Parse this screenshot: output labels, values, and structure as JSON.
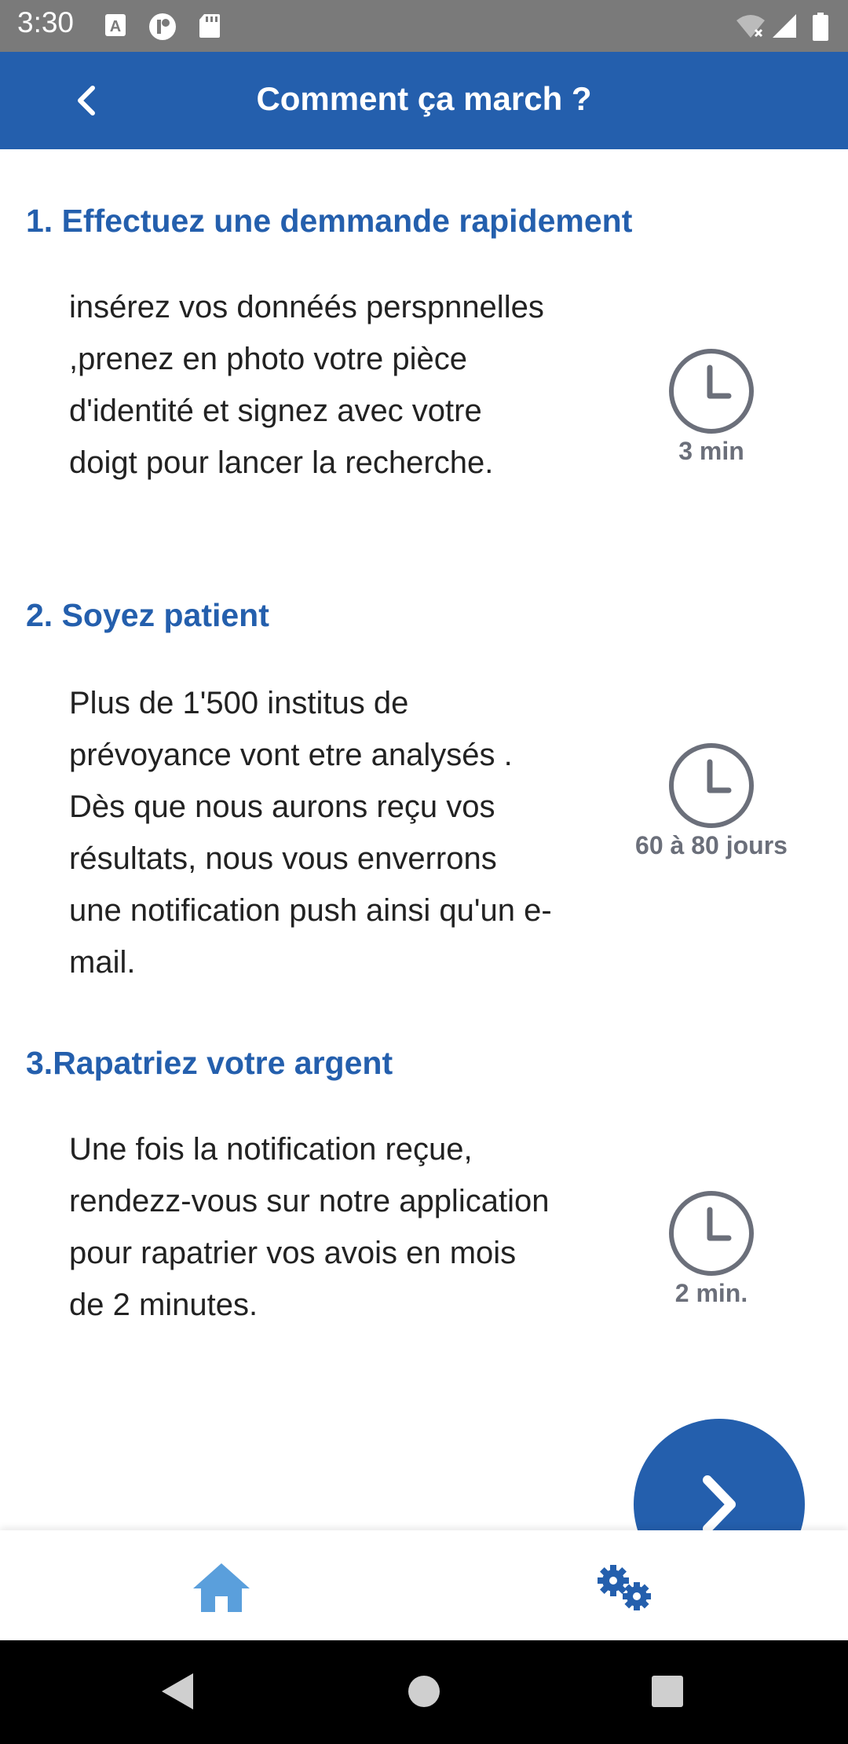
{
  "status_bar": {
    "time": "3:30",
    "icons_left": [
      "keyboard-a-icon",
      "notification-app-icon",
      "sd-card-icon"
    ],
    "icons_right": [
      "wifi-icon",
      "signal-icon",
      "battery-icon"
    ]
  },
  "app_bar": {
    "title": "Comment ça march ?",
    "back_icon": "chevron-left-icon"
  },
  "sections": [
    {
      "heading": "1. Effectuez une demmande rapidement",
      "body": "insérez vos donnéés perspnnelles ,prenez en photo votre pièce d'identité et signez avec votre doigt pour lancer la recherche.",
      "duration": "3 min"
    },
    {
      "heading": "2. Soyez patient",
      "body": "Plus de 1'500 institus de prévoyance vont etre analysés . Dès que nous aurons reçu vos résultats, nous vous enverrons une notification push ainsi qu'un e-mail.",
      "duration": "60 à 80 jours"
    },
    {
      "heading": "3.Rapatriez votre argent",
      "body": "Une fois la notification reçue, rendezz-vous sur notre application pour rapatrier vos avois en mois de 2 minutes.",
      "duration": "2 min."
    }
  ],
  "fab": {
    "icon": "chevron-right-icon"
  },
  "bottom_nav": {
    "items": [
      {
        "icon": "home-icon",
        "active": true
      },
      {
        "icon": "settings-gears-icon",
        "active": false
      }
    ]
  },
  "colors": {
    "primary": "#245fad",
    "status_bar": "#7a7a7a",
    "home_active": "#5a9fdc",
    "clock": "#6b6f7a"
  }
}
